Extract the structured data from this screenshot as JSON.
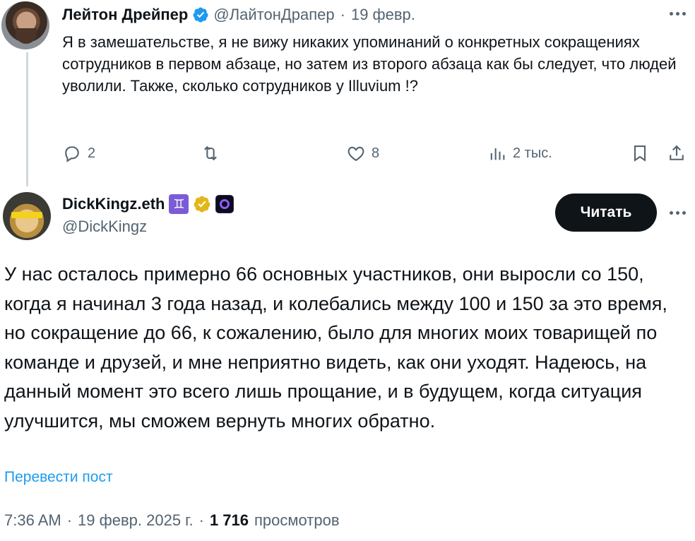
{
  "reply": {
    "author_name": "Лейтон Дрейпер",
    "handle": "@ЛайтонДрапер",
    "date": "19 февр.",
    "text": "Я в замешательстве, я не вижу никаких упоминаний о конкретных сокращениях сотрудников в первом абзаце, но затем из второго абзаца как бы следует, что людей уволили. Также, сколько сотрудников у Illuvium !?",
    "replies_count": "2",
    "likes_count": "8",
    "views_count": "2 тыс."
  },
  "main": {
    "author_name": "DickKingz.eth",
    "handle": "@DickKingz",
    "gemini_symbol": "♊",
    "read_button_label": "Читать",
    "text": "У нас осталось примерно 66 основных участников, они выросли со 150, когда я начинал 3 года назад, и колебались между 100 и 150 за это время, но сокращение до 66, к сожалению, было для многих моих товарищей по команде и друзей, и мне неприятно видеть, как они уходят. Надеюсь, на данный момент это всего лишь прощание, и в будущем, когда ситуация улучшится, мы сможем вернуть многих обратно.",
    "translate_link": "Перевести пост",
    "time": "7:36 AM",
    "full_date": "19 февр. 2025 г.",
    "views_count": "1 716",
    "views_label": "просмотров"
  },
  "colors": {
    "text": "#0f1419",
    "muted": "#536471",
    "link": "#1d9bf0",
    "verified_blue": "#1d9bf0",
    "verified_gold": "#e2b719",
    "button_bg": "#0f1419"
  },
  "icons": [
    "reply-icon",
    "retweet-icon",
    "like-icon",
    "views-icon",
    "bookmark-icon",
    "share-icon",
    "verified-icon",
    "more-icon"
  ]
}
